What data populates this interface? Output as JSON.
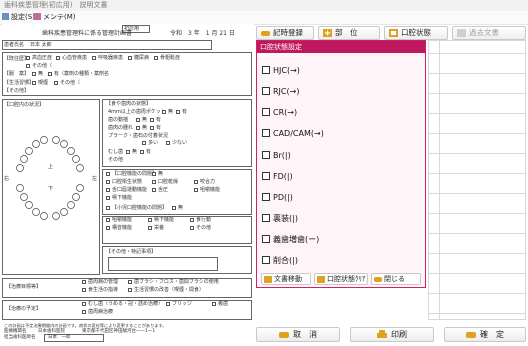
{
  "window": {
    "title": "歯科疾患管理(初広用)　説明文書"
  },
  "toolbar": {
    "settings_label": "設定(S)",
    "memo_label": "メンテ(M)"
  },
  "document": {
    "initial_label": "初診用",
    "title": "歯科疾患管理料に係る管理計画書",
    "date": "令和　3 年　1 月 21 日",
    "patient_name_label": "患者氏名",
    "patient_name": "日本 太郎",
    "section_history": "【既往歴】",
    "history_items": [
      "高血圧症",
      "心血管疾患",
      "呼吸器疾患",
      "糖尿病",
      "骨粗鬆症"
    ],
    "history_other": "その他（",
    "section_medication": "【服　薬】",
    "medication_items": [
      "無",
      "有（薬剤の種類・薬剤名"
    ],
    "section_lifestyle": "【生活習慣】",
    "lifestyle_items": [
      "喫煙",
      "その他（"
    ],
    "section_other": "【その他】",
    "mouth_section": "【口腔内の状況】",
    "section_oral_state": "【食や歯肉の状態】",
    "oral_state_items": [
      "4mm以上の歯周ポケット",
      "歯の動揺",
      "歯肉の腫れ",
      "プラーク・歯石の付着状況",
      "むし歯",
      "その他"
    ],
    "yes_no": [
      "無",
      "有"
    ],
    "amount": [
      "多い",
      "少ない"
    ],
    "chart_labels": {
      "right": "右",
      "left": "左",
      "upper": "上",
      "lower": "下"
    },
    "section_function": "【口腔機能の問題】",
    "function_items": [
      "口腔衛生状態",
      "口腔乾燥",
      "咬合力",
      "舌口唇運動機能",
      "舌圧",
      "咀嚼機能",
      "嚥下機能"
    ],
    "section_child": "【小児口腔機能の問題】",
    "child_items": [
      "咀嚼機能",
      "嚥下機能",
      "食行動",
      "構音機能",
      "栄養",
      "その他"
    ],
    "section_notes": "【その他・特記事項】",
    "section_goal": "【治療目標等】",
    "section_plan": "【治療の予定】",
    "goal_items": [
      "歯周病の管理",
      "歯ブラシ・フロス・歯間ブラシの使用",
      "食生活の指導",
      "生活習慣の改善（喫煙・間食）"
    ],
    "plan_items": [
      "むし歯（うめる・冠・詰め治療）",
      "ブリッジ",
      "義歯",
      "歯周病治療"
    ],
    "footer_note": "この計画は予定治療期間内の計画です。病状の変化等により変更することがあります。",
    "facility_label": "医療機関名",
    "facility": "日本歯科医院",
    "address": "東京都千代田区神田駿河台一ー1ー1",
    "doctor_label": "担当歯科医師名",
    "doctor": "日本　一郎"
  },
  "right_toolbar": {
    "record_label": "記時登録",
    "part_label": "部　位",
    "oral_state_label": "口腔状態",
    "move_label": "過去文書"
  },
  "panel": {
    "title": "口腔状態設定",
    "options": [
      "HJC(→)",
      "RJC(→)",
      "CR(→)",
      "CAD/CAM(→)",
      "Br(|)",
      "FD(|)",
      "PD(|)",
      "裏装(|)",
      "義歯増歯(ー)",
      "削合(|)"
    ],
    "btn_move": "文書移動",
    "btn_clear": "口腔状態ｸﾘｱ",
    "btn_close": "閉じる"
  },
  "bottom": {
    "cancel": "取　消",
    "print": "印刷",
    "confirm": "確　定"
  },
  "colors": {
    "accent": "#c0185e",
    "panel_bg": "#fff5f8",
    "icon_gold": "#e0a020"
  }
}
